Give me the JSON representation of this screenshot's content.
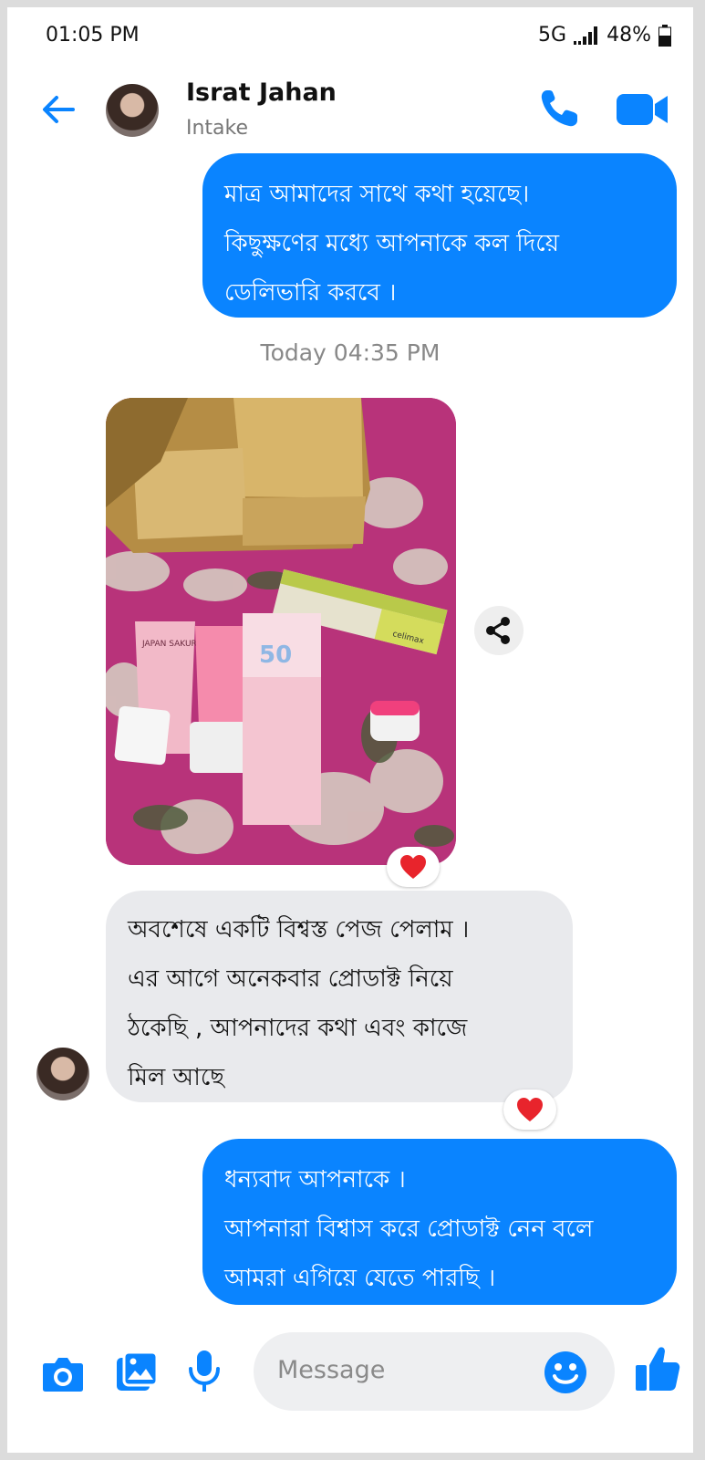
{
  "status_bar": {
    "time": "01:05 PM",
    "network": "5G",
    "battery": "48%"
  },
  "header": {
    "contact_name": "Israt Jahan",
    "contact_status": "Intake"
  },
  "messages": {
    "msg1": {
      "lines": [
        "মাত্র আমাদের সাথে কথা হয়েছে।",
        "কিছুক্ষণের মধ্যে আপনাকে কল দিয়ে",
        "ডেলিভারি করবে ।"
      ]
    },
    "timestamp": "Today 04:35 PM",
    "msg3": {
      "lines": [
        "অবশেষে একটি বিশ্বস্ত পেজ পেলাম ।",
        "এর আগে অনেকবার প্রোডাক্ট নিয়ে",
        "ঠকেছি , আপনাদের কথা এবং কাজে",
        "মিল আছে"
      ]
    },
    "msg4": {
      "lines": [
        "ধন্যবাদ আপনাকে ।",
        "আপনারা বিশ্বাস করে প্রোডাক্ট নেন বলে",
        "আমরা এগিয়ে যেতে পারছি ।"
      ]
    }
  },
  "photo": {
    "tube_text": "JAPAN SAKURA CLEANSER",
    "spf_text": "50",
    "box_text": "celimax"
  },
  "reactions": [
    "heart",
    "heart"
  ],
  "composer": {
    "placeholder": "Message"
  },
  "colors": {
    "accent": "#0a84ff",
    "incoming_bubble": "#e9eaed",
    "heart": "#e8242c"
  },
  "icons": [
    "back-arrow-icon",
    "phone-icon",
    "video-camera-icon",
    "share-icon",
    "heart-icon",
    "camera-icon",
    "gallery-icon",
    "microphone-icon",
    "emoji-icon",
    "thumbs-up-icon"
  ]
}
